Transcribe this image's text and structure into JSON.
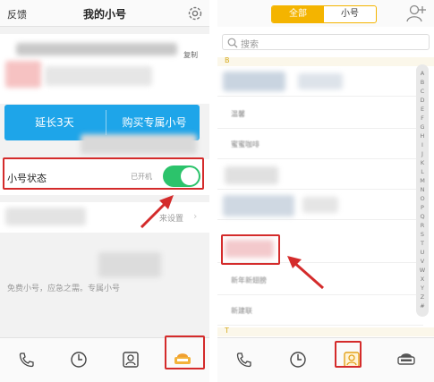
{
  "left": {
    "header": {
      "feedback": "反馈",
      "title": "我的小号",
      "settings_icon": "gear-icon"
    },
    "card": {
      "copy_label": "复制"
    },
    "buttons": {
      "extend": "延长3天",
      "buy": "购买专属小号"
    },
    "status": {
      "label": "小号状态",
      "state": "已开机",
      "toggle_on": true
    },
    "settings_row": {
      "label": "来设置",
      "chevron": "›"
    },
    "free_note": "免费小号，应急之需。专属小号",
    "tabs": [
      {
        "icon": "phone-icon"
      },
      {
        "icon": "clock-icon"
      },
      {
        "icon": "contacts-icon"
      },
      {
        "icon": "mask-icon",
        "active": true
      }
    ]
  },
  "right": {
    "header": {
      "tab_all": "全部",
      "tab_sub": "小号",
      "add_icon": "add-user-icon"
    },
    "search": {
      "placeholder": "搜索"
    },
    "section_b": "B",
    "section_t": "T",
    "contacts": [
      "",
      "温馨",
      "蜜蜜咖啡",
      "",
      "",
      "",
      "",
      "联系人",
      "新年新翅膀",
      "",
      "",
      "",
      "新建联"
    ],
    "index_letters": [
      "A",
      "B",
      "C",
      "D",
      "E",
      "F",
      "G",
      "H",
      "I",
      "J",
      "K",
      "L",
      "M",
      "N",
      "O",
      "P",
      "Q",
      "R",
      "S",
      "T",
      "U",
      "V",
      "W",
      "X",
      "Y",
      "Z",
      "#"
    ],
    "tabs": [
      {
        "icon": "phone-icon"
      },
      {
        "icon": "clock-icon"
      },
      {
        "icon": "contacts-icon",
        "active": true
      },
      {
        "icon": "mask-icon"
      }
    ]
  },
  "colors": {
    "accent_blue": "#1ea5e9",
    "toggle_green": "#2cc36b",
    "highlight_red": "#d42b2b",
    "tab_yellow": "#f4b400"
  }
}
